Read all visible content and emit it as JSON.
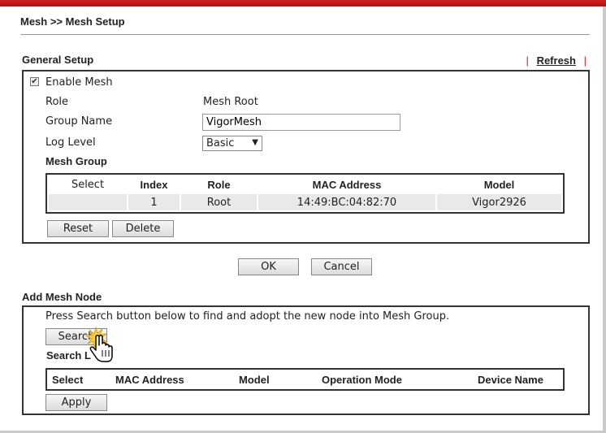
{
  "breadcrumb": "Mesh >> Mesh Setup",
  "general_setup": {
    "title": "General Setup",
    "refresh_label": "Refresh",
    "pipe": "|",
    "enable_mesh_label": "Enable Mesh",
    "enable_mesh_checked": true,
    "role_label": "Role",
    "role_value": "Mesh Root",
    "group_name_label": "Group Name",
    "group_name_value": "VigorMesh",
    "log_level_label": "Log Level",
    "log_level_value": "Basic",
    "mesh_group_label": "Mesh Group",
    "table": {
      "headers": [
        "Select",
        "Index",
        "Role",
        "MAC Address",
        "Model"
      ],
      "rows": [
        {
          "select": "",
          "index": "1",
          "role": "Root",
          "mac": "14:49:BC:04:82:70",
          "model": "Vigor2926"
        }
      ]
    },
    "reset_label": "Reset",
    "delete_label": "Delete"
  },
  "actions": {
    "ok_label": "OK",
    "cancel_label": "Cancel"
  },
  "add_mesh_node": {
    "title": "Add Mesh Node",
    "hint": "Press Search button below to find and adopt the new node into Mesh Group.",
    "search_label": "Search",
    "search_list_label": "Search L",
    "table_headers": [
      "Select",
      "MAC Address",
      "Model",
      "Operation Mode",
      "Device Name"
    ],
    "apply_label": "Apply"
  },
  "icons": {
    "cursor": "hand-pointer-icon",
    "check": "checkmark-icon"
  },
  "colors": {
    "topbar": "#c81818",
    "accent_pipe": "#d02020"
  }
}
